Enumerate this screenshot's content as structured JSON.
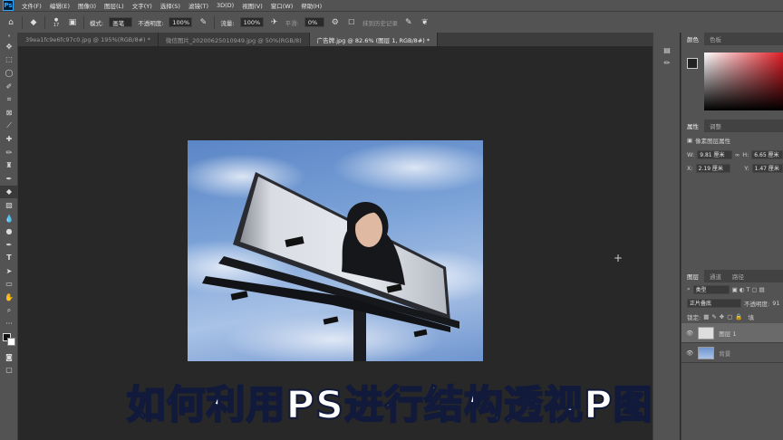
{
  "app": {
    "logo_text": "Ps"
  },
  "menu": [
    "文件(F)",
    "编辑(E)",
    "图像(I)",
    "图层(L)",
    "文字(Y)",
    "选择(S)",
    "滤镜(T)",
    "3D(D)",
    "视图(V)",
    "窗口(W)",
    "帮助(H)"
  ],
  "options": {
    "brush_size": "17",
    "mode_label": "模式:",
    "mode_value": "画笔",
    "opacity_label": "不透明度:",
    "opacity_value": "100%",
    "flow_label": "流量:",
    "flow_value": "100%",
    "smooth_label": "平滑:",
    "smooth_value": "0%",
    "erase_history_label": "抹到历史记录"
  },
  "tabs": [
    {
      "label": "39ea1fc9e6fc97c0.jpg @ 195%(RGB/8#) *"
    },
    {
      "label": "微信图片_20200625010949.jpg @ 50%(RGB/8)"
    },
    {
      "label": "广告牌.jpg @ 82.6% (图层 1, RGB/8#) *"
    }
  ],
  "color_panel": {
    "tab_color": "颜色",
    "tab_swatches": "色板"
  },
  "properties": {
    "tab_props": "属性",
    "tab_adjust": "调整",
    "title": "像素图层属性",
    "w_label": "W:",
    "w_value": "9.81 厘米",
    "h_label": "H:",
    "h_value": "6.65 厘米",
    "x_label": "X:",
    "x_value": "2.19 厘米",
    "y_label": "Y:",
    "y_value": "1.47 厘米"
  },
  "layers_panel": {
    "tab_layers": "图层",
    "tab_channels": "通道",
    "tab_paths": "路径",
    "filter_kind": "类型",
    "blend_mode": "正片叠底",
    "opacity_label": "不透明度:",
    "opacity_value": "91",
    "lock_label": "锁定:",
    "fill_label": "填",
    "layers": [
      {
        "name": "图层 1"
      },
      {
        "name": "背景"
      }
    ]
  },
  "caption": "如何利用PS进行结构透视P图",
  "colors": {
    "accent": "#31a8ff",
    "caption_stroke": "#111a3a"
  }
}
